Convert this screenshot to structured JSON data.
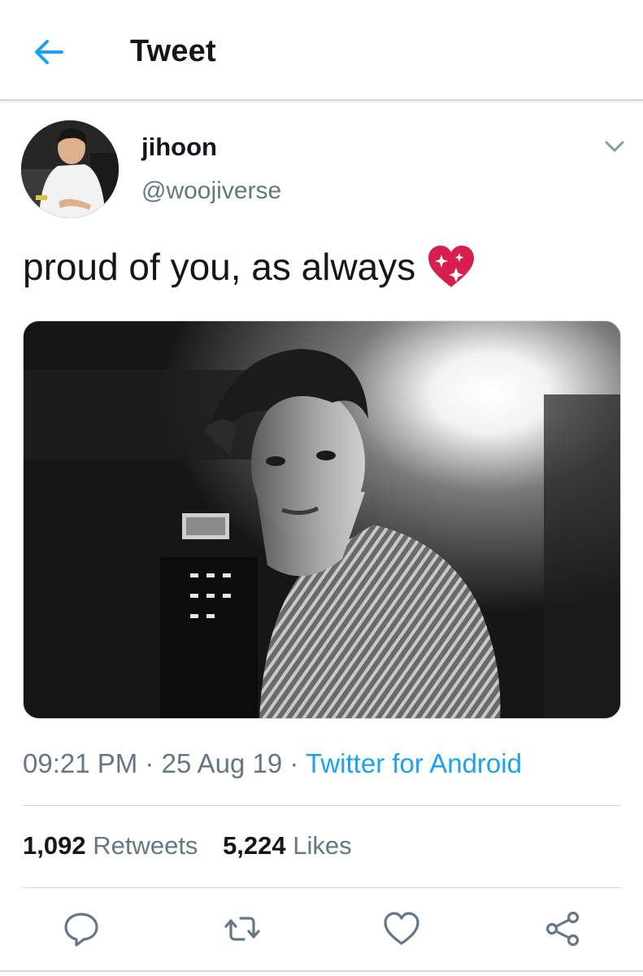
{
  "header": {
    "title": "Tweet",
    "back_icon": "arrow-left-icon"
  },
  "author": {
    "display_name": "jihoon",
    "handle": "@woojiverse",
    "menu_icon": "chevron-down-icon"
  },
  "tweet": {
    "text": "proud of you, as always",
    "emoji": "sparkling-heart-icon",
    "photo_alt": "Black and white photo of a young man in a striped shirt backstage"
  },
  "meta": {
    "time": "09:21 PM",
    "date": "25 Aug 19",
    "separator": "·",
    "source": "Twitter for Android"
  },
  "stats": {
    "retweets_count": "1,092",
    "retweets_label": "Retweets",
    "likes_count": "5,224",
    "likes_label": "Likes"
  },
  "actions": [
    "reply-icon",
    "retweet-icon",
    "like-icon",
    "share-icon"
  ],
  "colors": {
    "accent": "#1da1f2",
    "secondary_text": "#657786",
    "primary_text": "#14171a",
    "heart": "#d81e4f"
  }
}
